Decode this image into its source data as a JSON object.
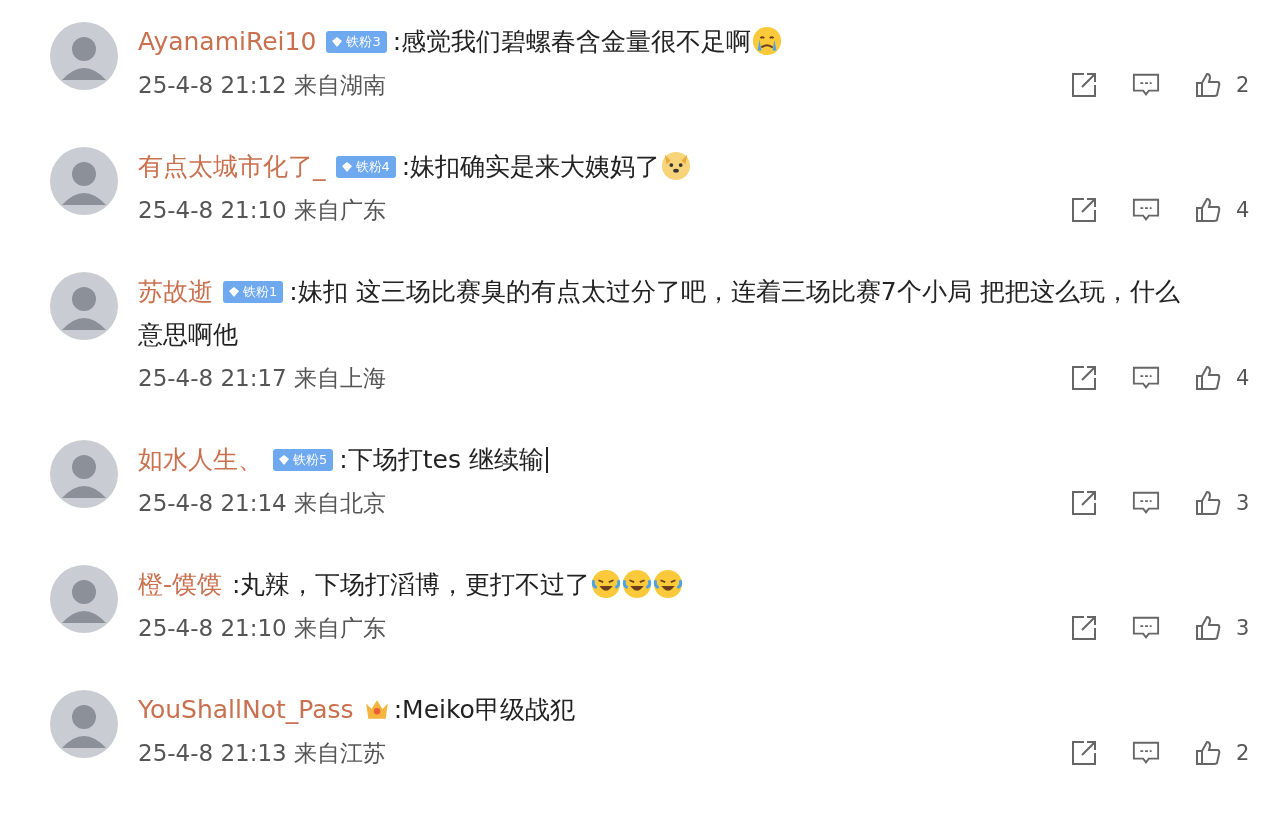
{
  "comments": [
    {
      "user": "AyanamiRei10",
      "badge": {
        "kind": "fan",
        "label": "铁粉3"
      },
      "text": ":感觉我们碧螺春含金量很不足啊",
      "emojis": [
        {
          "kind": "crying"
        }
      ],
      "cursor": false,
      "time": "25-4-8 21:12 来自湖南",
      "likes": "2"
    },
    {
      "user": "有点太城市化了_",
      "badge": {
        "kind": "fan",
        "label": "铁粉4"
      },
      "text": ":妹扣确实是来大姨妈了",
      "emojis": [
        {
          "kind": "dog"
        }
      ],
      "cursor": false,
      "time": "25-4-8 21:10 来自广东",
      "likes": "4"
    },
    {
      "user": "苏故逝",
      "badge": {
        "kind": "fan",
        "label": "铁粉1"
      },
      "text": ":妹扣 这三场比赛臭的有点太过分了吧，连着三场比赛7个小局 把把这么玩，什么",
      "text_continued": "意思啊他",
      "cursor": false,
      "time": "25-4-8 21:17 来自上海",
      "likes": "4"
    },
    {
      "user": "如水人生、",
      "badge": {
        "kind": "fan",
        "label": "铁粉5"
      },
      "text": ":下场打tes  继续输",
      "cursor": true,
      "time": "25-4-8 21:14 来自北京",
      "likes": "3"
    },
    {
      "user": "橙-馍馍",
      "text": ":丸辣，下场打滔博，更打不过了",
      "emojis": [
        {
          "kind": "laugh-cry"
        },
        {
          "kind": "laugh-cry"
        },
        {
          "kind": "laugh-cry"
        }
      ],
      "cursor": false,
      "time": "25-4-8 21:10 来自广东",
      "likes": "3"
    },
    {
      "user": "YouShallNot_Pass",
      "badge": {
        "kind": "crown"
      },
      "text": ":Meiko甲级战犯",
      "cursor": false,
      "time": "25-4-8 21:13 来自江苏",
      "likes": "2"
    }
  ]
}
